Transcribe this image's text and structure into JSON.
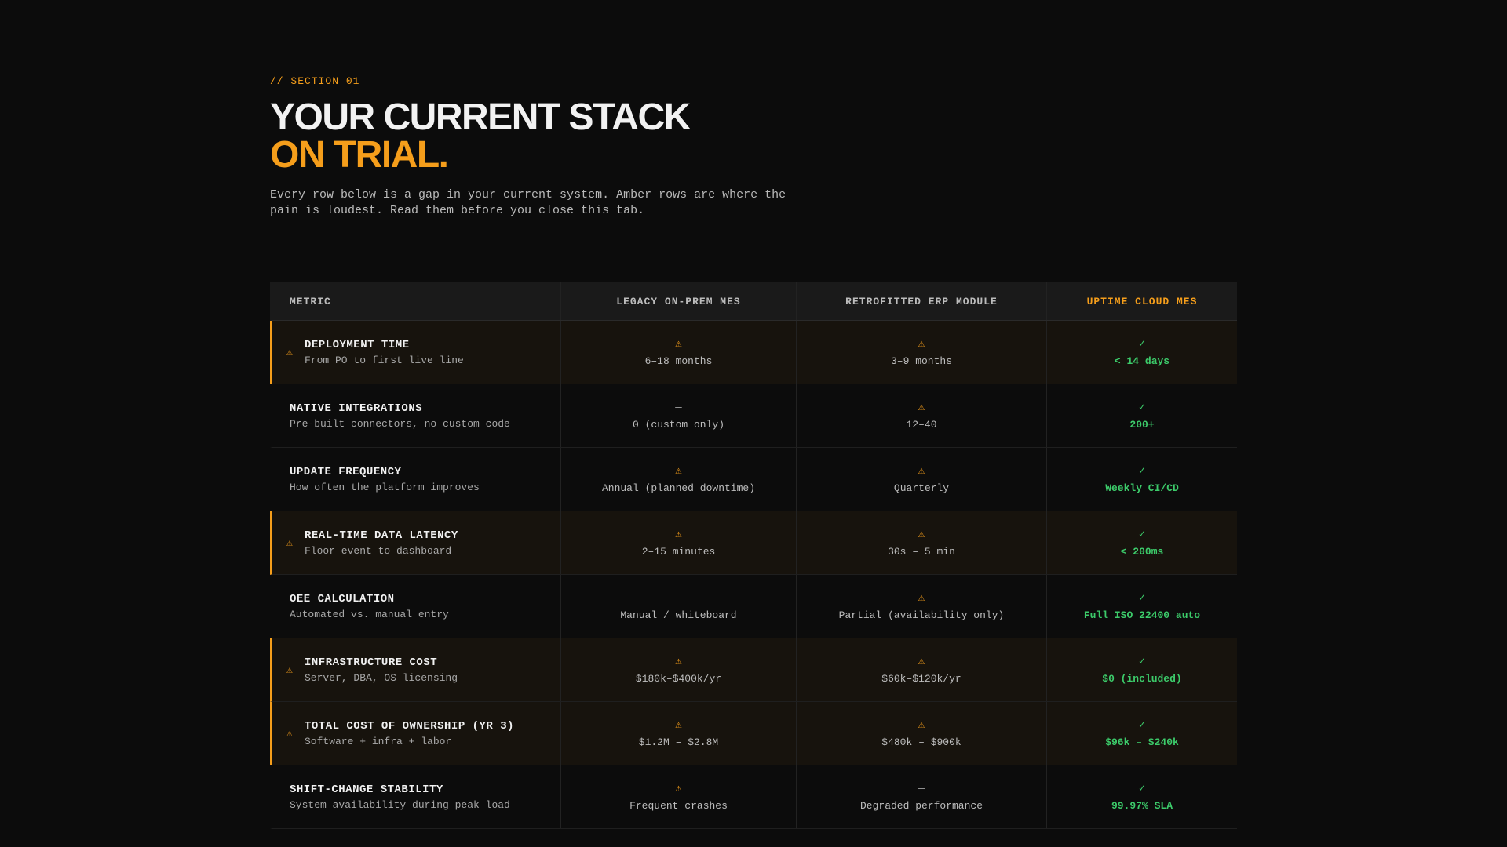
{
  "section": {
    "eyebrow": "// SECTION 01",
    "title_line1": "YOUR CURRENT STACK",
    "title_line2": "ON TRIAL.",
    "subtitle": "Every row below is a gap in your current system. Amber rows are where the pain is loudest. Read them before you close this tab."
  },
  "colors": {
    "accent": "#f59e1b",
    "good": "#3ccb6a",
    "background": "#0c0c0c"
  },
  "table": {
    "headers": [
      "METRIC",
      "LEGACY ON-PREM MES",
      "RETROFITTED ERP MODULE",
      "UPTIME CLOUD MES"
    ],
    "icons": {
      "warn": "⚠",
      "dash": "—",
      "check": "✓"
    },
    "rows": [
      {
        "name": "DEPLOYMENT TIME",
        "desc": "From PO to first live line",
        "amber": true,
        "legacy": {
          "icon": "warn",
          "text": "6–18 months"
        },
        "erp": {
          "icon": "warn",
          "text": "3–9 months"
        },
        "cloud": {
          "icon": "check",
          "text": "< 14 days"
        }
      },
      {
        "name": "NATIVE INTEGRATIONS",
        "desc": "Pre-built connectors, no custom code",
        "amber": false,
        "legacy": {
          "icon": "dash",
          "text": "0 (custom only)"
        },
        "erp": {
          "icon": "warn",
          "text": "12–40"
        },
        "cloud": {
          "icon": "check",
          "text": "200+"
        }
      },
      {
        "name": "UPDATE FREQUENCY",
        "desc": "How often the platform improves",
        "amber": false,
        "legacy": {
          "icon": "warn",
          "text": "Annual (planned downtime)"
        },
        "erp": {
          "icon": "warn",
          "text": "Quarterly"
        },
        "cloud": {
          "icon": "check",
          "text": "Weekly CI/CD"
        }
      },
      {
        "name": "REAL-TIME DATA LATENCY",
        "desc": "Floor event to dashboard",
        "amber": true,
        "legacy": {
          "icon": "warn",
          "text": "2–15 minutes"
        },
        "erp": {
          "icon": "warn",
          "text": "30s – 5 min"
        },
        "cloud": {
          "icon": "check",
          "text": "< 200ms"
        }
      },
      {
        "name": "OEE CALCULATION",
        "desc": "Automated vs. manual entry",
        "amber": false,
        "legacy": {
          "icon": "dash",
          "text": "Manual / whiteboard"
        },
        "erp": {
          "icon": "warn",
          "text": "Partial (availability only)"
        },
        "cloud": {
          "icon": "check",
          "text": "Full ISO 22400 auto"
        }
      },
      {
        "name": "INFRASTRUCTURE COST",
        "desc": "Server, DBA, OS licensing",
        "amber": true,
        "legacy": {
          "icon": "warn",
          "text": "$180k–$400k/yr"
        },
        "erp": {
          "icon": "warn",
          "text": "$60k–$120k/yr"
        },
        "cloud": {
          "icon": "check",
          "text": "$0 (included)"
        }
      },
      {
        "name": "TOTAL COST OF OWNERSHIP (YR 3)",
        "desc": "Software + infra + labor",
        "amber": true,
        "legacy": {
          "icon": "warn",
          "text": "$1.2M – $2.8M"
        },
        "erp": {
          "icon": "warn",
          "text": "$480k – $900k"
        },
        "cloud": {
          "icon": "check",
          "text": "$96k – $240k"
        }
      },
      {
        "name": "SHIFT-CHANGE STABILITY",
        "desc": "System availability during peak load",
        "amber": false,
        "legacy": {
          "icon": "warn",
          "text": "Frequent crashes"
        },
        "erp": {
          "icon": "dash",
          "text": "Degraded performance"
        },
        "cloud": {
          "icon": "check",
          "text": "99.97% SLA"
        }
      }
    ]
  }
}
